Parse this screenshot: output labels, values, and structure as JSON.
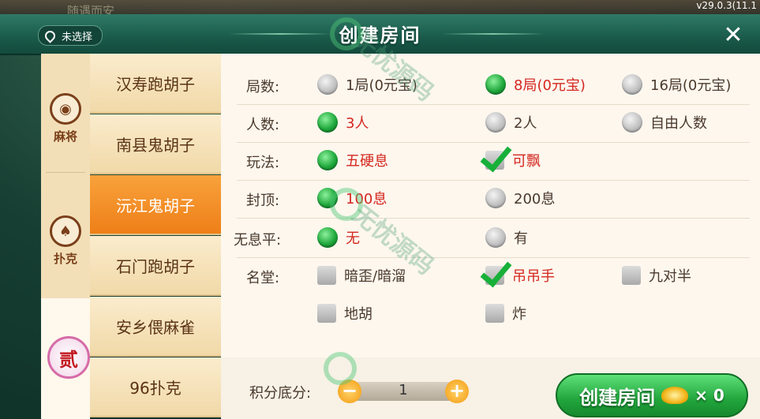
{
  "header": {
    "faint_text": "随遇而安",
    "version": "v29.0.3(11.1",
    "location": "未选择",
    "title": "创建房间",
    "close_icon": "close-icon"
  },
  "categories": [
    {
      "label": "麻将",
      "icon": "mahjong-icon"
    },
    {
      "label": "扑克",
      "icon": "spade-icon"
    },
    {
      "label": "贰",
      "icon": "badge-icon"
    }
  ],
  "games": [
    {
      "label": "汉寿跑胡子",
      "selected": false
    },
    {
      "label": "南县鬼胡子",
      "selected": false
    },
    {
      "label": "沅江鬼胡子",
      "selected": true
    },
    {
      "label": "石门跑胡子",
      "selected": false
    },
    {
      "label": "安乡偎麻雀",
      "selected": false
    },
    {
      "label": "96扑克",
      "selected": false
    }
  ],
  "options": {
    "rounds": {
      "label": "局数:",
      "choices": [
        "1局(0元宝)",
        "8局(0元宝)",
        "16局(0元宝)"
      ],
      "selected": 1
    },
    "players": {
      "label": "人数:",
      "choices": [
        "3人",
        "2人",
        "自由人数"
      ],
      "selected": 0
    },
    "play": {
      "label": "玩法:",
      "choices": [
        "五硬息",
        "可飘"
      ],
      "selected": [
        0,
        1
      ]
    },
    "cap": {
      "label": "封顶:",
      "choices": [
        "100息",
        "200息"
      ],
      "selected": 0
    },
    "no_xi": {
      "label": "无息平:",
      "choices": [
        "无",
        "有"
      ],
      "selected": 0
    },
    "hall": {
      "label": "名堂:",
      "choices": [
        "暗歪/暗溜",
        "吊吊手",
        "九对半",
        "地胡",
        "炸"
      ],
      "checked": [
        1
      ]
    }
  },
  "bottom": {
    "score_label": "积分底分:",
    "score_value": "1",
    "minus": "−",
    "plus": "+",
    "create_label": "创建房间",
    "count": "× 0"
  },
  "watermark": {
    "text": "无忧源码"
  },
  "colors": {
    "accent_green": "#1fa83b",
    "selected_tab": "#ef7f18",
    "selected_text": "#d4271f"
  }
}
